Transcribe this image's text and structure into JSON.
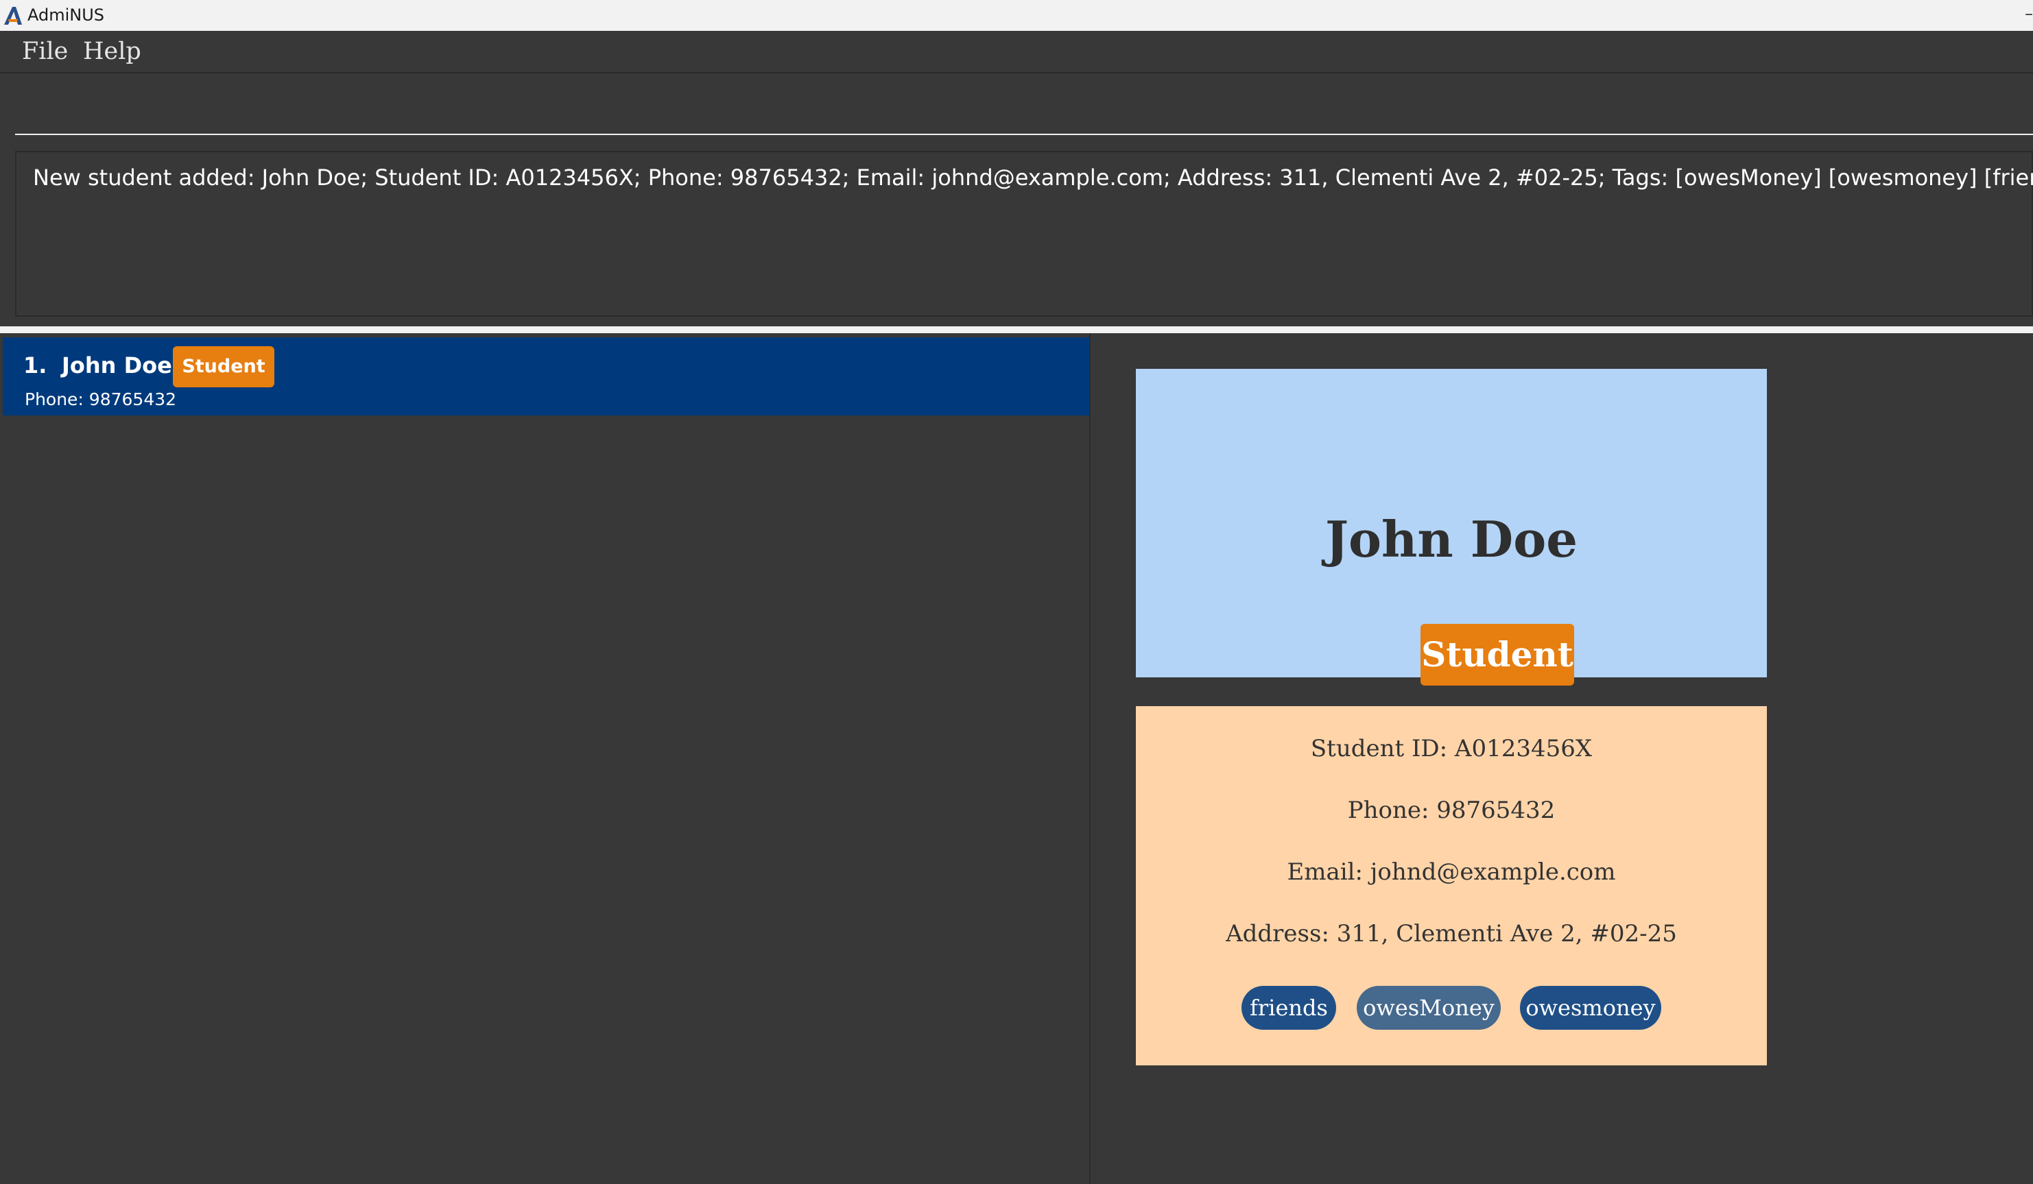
{
  "app": {
    "title": "AdmiNUS",
    "minimize_glyph": "–"
  },
  "menu": {
    "items": [
      "File",
      "Help"
    ]
  },
  "command": {
    "value": "",
    "placeholder": ""
  },
  "result": {
    "message": "New student added: John Doe; Student ID: A0123456X; Phone: 98765432; Email: johnd@example.com; Address: 311, Clementi Ave 2, #02-25; Tags: [owesMoney] [owesmoney] [friends]"
  },
  "list": {
    "items": [
      {
        "index": "1.",
        "name": "John Doe",
        "role": "Student",
        "phone": "Phone: 98765432"
      }
    ]
  },
  "detail": {
    "name": "John Doe",
    "role": "Student",
    "student_id": "Student ID: A0123456X",
    "phone": "Phone: 98765432",
    "email": "Email: johnd@example.com",
    "address": "Address: 311, Clementi Ave 2, #02-25",
    "tags": [
      "friends",
      "owesMoney",
      "owesmoney"
    ]
  },
  "colors": {
    "selected_row": "#003a7c",
    "role_badge": "#e67e10",
    "name_card": "#b3d4f6",
    "info_card": "#ffd4a8",
    "tag": "#1f4f86",
    "tag_highlight": "#46698e"
  }
}
